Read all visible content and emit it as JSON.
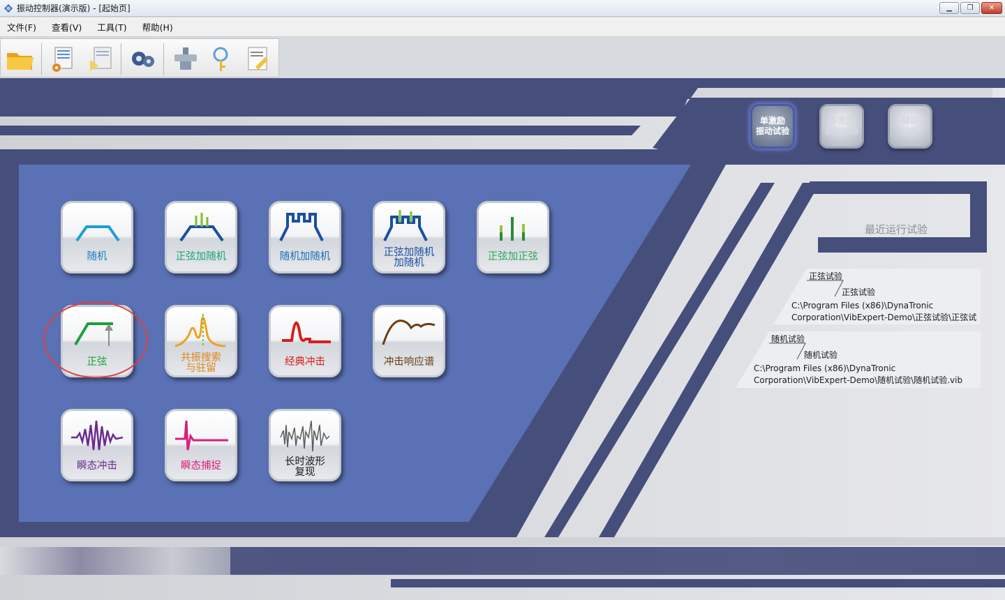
{
  "window": {
    "title": "振动控制器(演示版) - [起始页]",
    "buttons": [
      "minimize",
      "restore",
      "close"
    ]
  },
  "menubar": {
    "items": [
      {
        "label": "文件(F)"
      },
      {
        "label": "查看(V)"
      },
      {
        "label": "工具(T)"
      },
      {
        "label": "帮助(H)"
      }
    ]
  },
  "toolbar": {
    "buttons": [
      {
        "icon": "open-folder-icon"
      },
      {
        "icon": "test-settings-icon"
      },
      {
        "icon": "run-test-icon"
      },
      {
        "icon": "system-settings-gear-icon"
      },
      {
        "icon": "hardware-icon"
      },
      {
        "icon": "search-key-icon"
      },
      {
        "icon": "notes-icon"
      }
    ]
  },
  "categories": {
    "single": {
      "label": "单激励\n振动试验",
      "state": "active"
    },
    "multi": {
      "label": "多激励\n振动试验",
      "state": "disabled"
    },
    "aux": {
      "label": "辅助\n功能",
      "state": "normal"
    }
  },
  "tests": [
    {
      "label": "随机",
      "color": "#1a7fc4"
    },
    {
      "label": "正弦加随机",
      "color": "#1aa37a"
    },
    {
      "label": "随机加随机",
      "color": "#1a6fb8"
    },
    {
      "label": "正弦加随机\n加随机",
      "color": "#1a4fa0"
    },
    {
      "label": "正弦加正弦",
      "color": "#2ea75c"
    },
    {
      "label": "正弦",
      "color": "#1d9e3a"
    },
    {
      "label": "共振搜索\n与驻留",
      "color": "#e0861a"
    },
    {
      "label": "经典冲击",
      "color": "#d81e1e"
    },
    {
      "label": "冲击响应谱",
      "color": "#6a3d16"
    },
    {
      "label": "瞬态冲击",
      "color": "#6c2a8e"
    },
    {
      "label": "瞬态捕捉",
      "color": "#d81e7a"
    },
    {
      "label": "长时波形\n复现",
      "color": "#1b1b1b"
    }
  ],
  "recent": {
    "title": "最近运行试验",
    "items": [
      {
        "category": "正弦试验",
        "name": "正弦试验",
        "path_line1": "C:\\Program Files (x86)\\DynaTronic",
        "path_line2": "Corporation\\VibExpert-Demo\\正弦试验\\正弦试"
      },
      {
        "category": "随机试验",
        "name": "随机试验",
        "path_line1": "C:\\Program Files (x86)\\DynaTronic",
        "path_line2": "Corporation\\VibExpert-Demo\\随机试验\\随机试验.vib"
      }
    ]
  },
  "colors": {
    "navy": "#464e7c",
    "panel_blue": "#5a71b5",
    "bg_gray": "#d6d8dc"
  }
}
